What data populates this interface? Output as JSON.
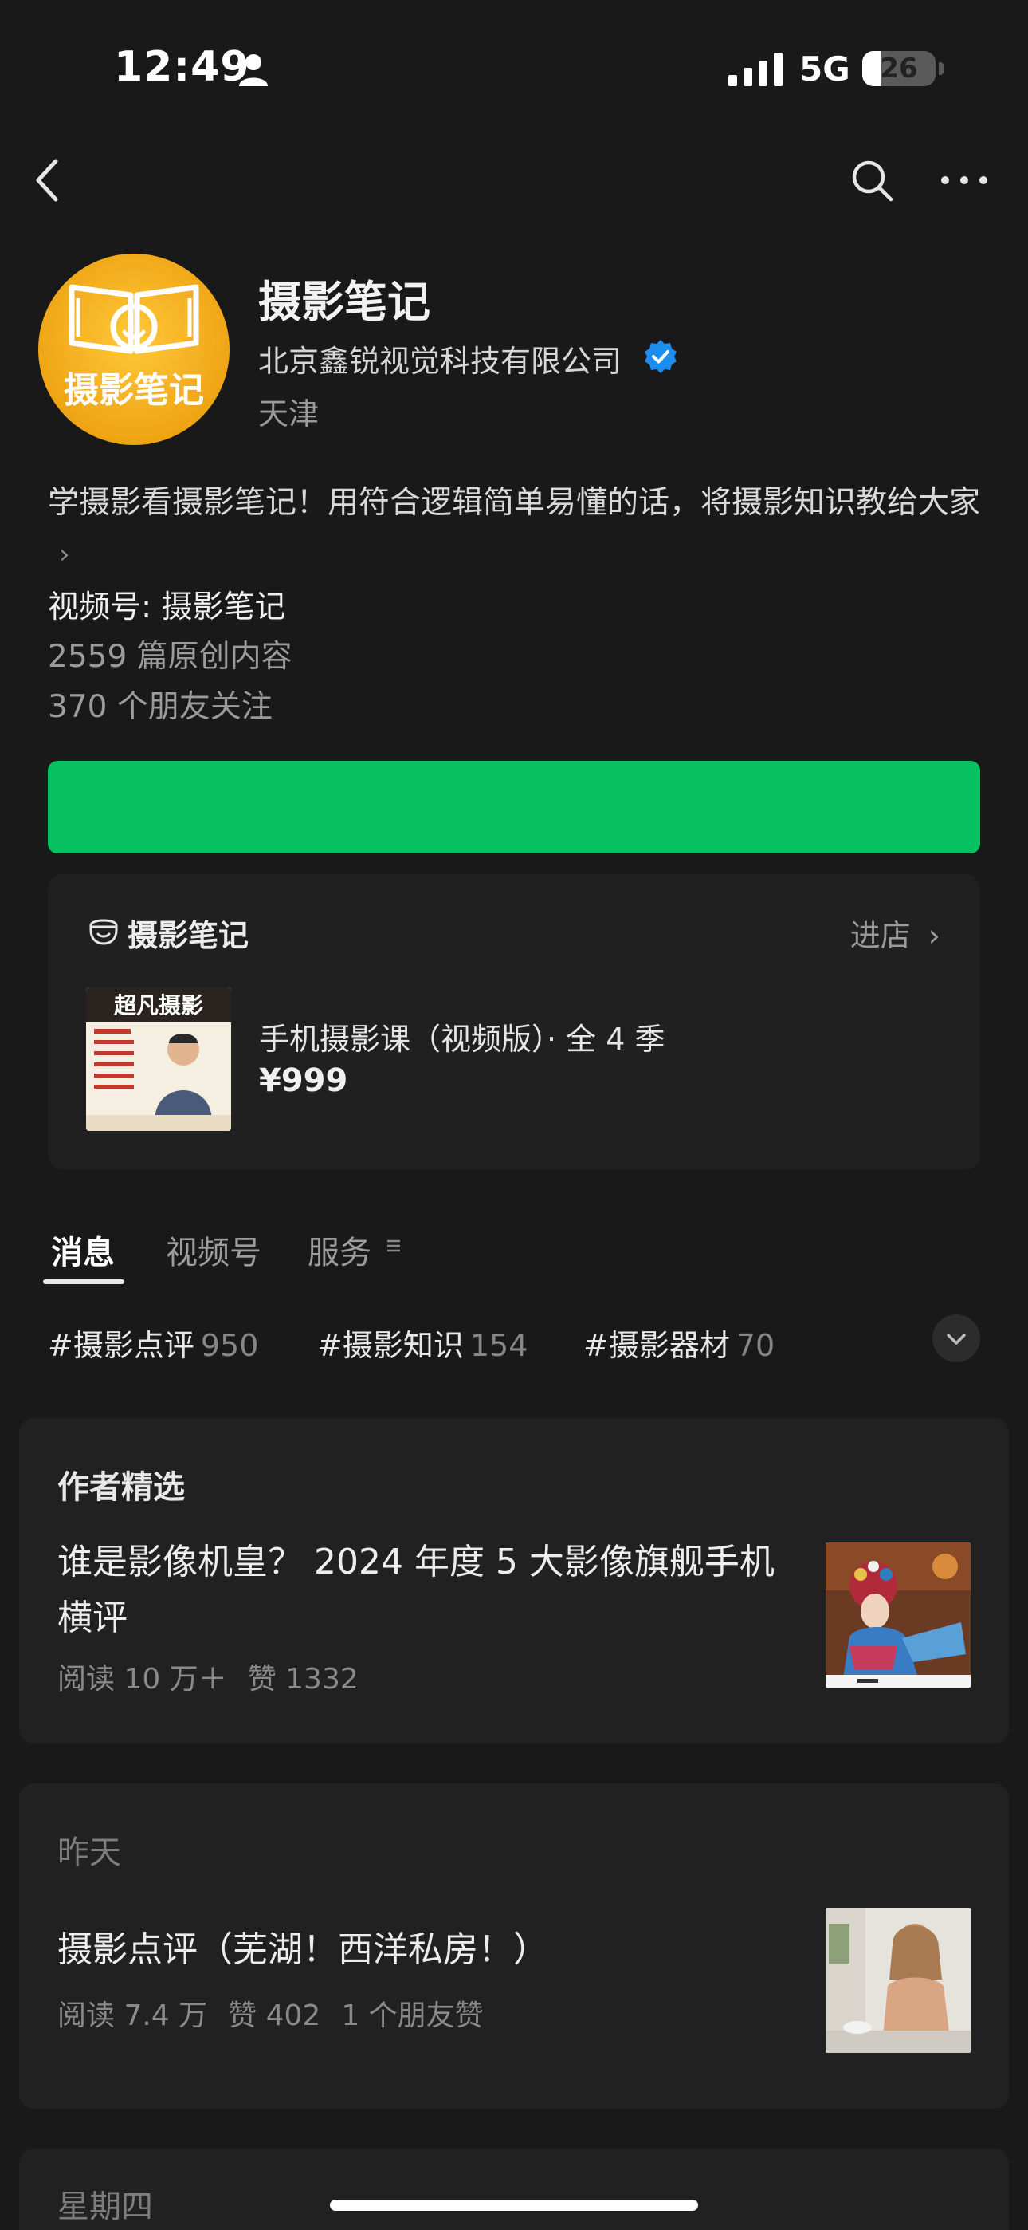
{
  "status_bar": {
    "time": "12:49",
    "network": "5G",
    "battery": "26",
    "battery_level_percent": 26
  },
  "nav": {
    "back_icon": "chevron-left-icon",
    "search_icon": "search-icon",
    "more_icon": "more-horizontal-icon"
  },
  "profile": {
    "name": "摄影笔记",
    "company": "北京鑫锐视觉科技有限公司",
    "location": "天津",
    "avatar_logo_text": "摄影笔记",
    "bio": "学摄影看摄影笔记！用符合逻辑简单易懂的话，将摄影知识教给大家",
    "channel": "视频号: 摄影笔记",
    "original_count": "2559 篇原创内容",
    "friends_following": "370 个朋友关注"
  },
  "colors": {
    "accent_green": "#07c160",
    "verified_blue": "#1d8ef0",
    "avatar_yellow": "#f4b31a"
  },
  "store": {
    "name": "摄影笔记",
    "enter_label": "进店",
    "product": {
      "title": "手机摄影课（视频版）· 全 4 季",
      "price": "¥999",
      "thumb_title": "超凡摄影"
    }
  },
  "tabs": [
    {
      "label": "消息",
      "active": true
    },
    {
      "label": "视频号",
      "active": false
    },
    {
      "label": "服务",
      "active": false
    }
  ],
  "hashtags": [
    {
      "label": "#摄影点评",
      "count": "950"
    },
    {
      "label": "#摄影知识",
      "count": "154"
    },
    {
      "label": "#摄影器材",
      "count": "70"
    }
  ],
  "featured": {
    "heading": "作者精选",
    "title": "谁是影像机皇？ 2024 年度 5 大影像旗舰手机横评",
    "reads": "阅读 10 万＋",
    "likes": "赞 1332"
  },
  "yesterday": {
    "heading": "昨天",
    "title": "摄影点评（芜湖！西洋私房！）",
    "reads": "阅读 7.4 万",
    "likes": "赞 402",
    "friends_likes": "1 个朋友赞"
  },
  "thursday": {
    "heading": "星期四"
  }
}
